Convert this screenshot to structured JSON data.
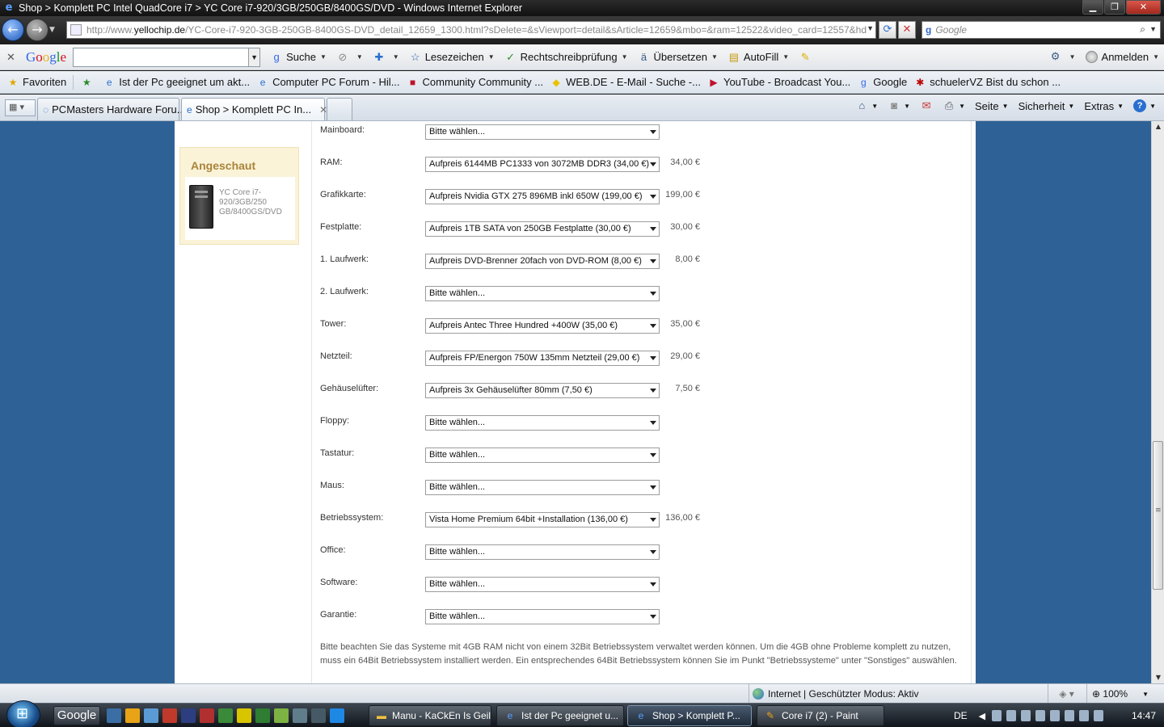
{
  "window": {
    "title": "Shop > Komplett PC Intel QuadCore i7 > YC Core i7-920/3GB/250GB/8400GS/DVD - Windows Internet Explorer",
    "minimize_glyph": "▁",
    "maximize_glyph": "❐",
    "close_glyph": "✕"
  },
  "address": {
    "prefix": "http://www.",
    "host": "yellochip.de",
    "path": "/YC-Core-i7-920-3GB-250GB-8400GS-DVD_detail_12659_1300.html?sDelete=&sViewport=detail&sArticle=12659&mbo=&ram=12522&video_card=12557&hd"
  },
  "search": {
    "engine_mark": "g",
    "placeholder": "Google"
  },
  "google_toolbar": {
    "logo": [
      "G",
      "o",
      "o",
      "g",
      "l",
      "e"
    ],
    "suche": "Suche",
    "lesezeichen": "Lesezeichen",
    "rechtschreib": "Rechtschreibprüfung",
    "uebersetzen": "Übersetzen",
    "autofill": "AutoFill",
    "anmelden": "Anmelden"
  },
  "favorites": {
    "label": "Favoriten",
    "items": [
      "Ist der Pc geeignet um akt...",
      "Computer PC Forum - Hil...",
      "Community  Community ...",
      "WEB.DE - E-Mail - Suche -...",
      "YouTube - Broadcast You...",
      "Google",
      "schuelerVZ  Bist du schon ..."
    ]
  },
  "tabs": [
    {
      "label": "PCMasters Hardware Foru..."
    },
    {
      "label": "Shop > Komplett PC In..."
    }
  ],
  "command_bar": {
    "seite": "Seite",
    "sicherheit": "Sicherheit",
    "extras": "Extras"
  },
  "sidebar": {
    "heading": "Angeschaut",
    "product_caption": "YC Core i7-920/3GB/250 GB/8400GS/DVD"
  },
  "config_rows": [
    {
      "label": "Mainboard:",
      "selected": "Bitte wählen...",
      "price": ""
    },
    {
      "label": "RAM:",
      "selected": "Aufpreis 6144MB PC1333 von 3072MB DDR3 (34,00 €)",
      "price": "34,00 €"
    },
    {
      "label": "Grafikkarte:",
      "selected": "Aufpreis Nvidia GTX 275 896MB inkl 650W (199,00 €)",
      "price": "199,00 €"
    },
    {
      "label": "Festplatte:",
      "selected": "Aufpreis 1TB SATA von 250GB Festplatte (30,00 €)",
      "price": "30,00 €"
    },
    {
      "label": "1. Laufwerk:",
      "selected": "Aufpreis DVD-Brenner 20fach von DVD-ROM (8,00 €)",
      "price": "8,00 €"
    },
    {
      "label": "2. Laufwerk:",
      "selected": "Bitte wählen...",
      "price": ""
    },
    {
      "label": "Tower:",
      "selected": "Aufpreis Antec Three Hundred +400W (35,00 €)",
      "price": "35,00 €"
    },
    {
      "label": "Netzteil:",
      "selected": "Aufpreis FP/Energon 750W 135mm Netzteil (29,00 €)",
      "price": "29,00 €"
    },
    {
      "label": "Gehäuselüfter:",
      "selected": "Aufpreis 3x Gehäuselüfter 80mm (7,50 €)",
      "price": "7,50 €"
    },
    {
      "label": "Floppy:",
      "selected": "Bitte wählen...",
      "price": ""
    },
    {
      "label": "Tastatur:",
      "selected": "Bitte wählen...",
      "price": ""
    },
    {
      "label": "Maus:",
      "selected": "Bitte wählen...",
      "price": ""
    },
    {
      "label": "Betriebssystem:",
      "selected": "Vista Home Premium 64bit +Installation (136,00 €)",
      "price": "136,00 €"
    },
    {
      "label": "Office:",
      "selected": "Bitte wählen...",
      "price": ""
    },
    {
      "label": "Software:",
      "selected": "Bitte wählen...",
      "price": ""
    },
    {
      "label": "Garantie:",
      "selected": "Bitte wählen...",
      "price": ""
    }
  ],
  "note": "Bitte beachten Sie das Systeme mit 4GB RAM nicht von einem 32Bit Betriebssystem verwaltet werden können. Um die 4GB ohne Probleme komplett zu nutzen, muss ein 64Bit Betriebssystem installiert werden. Ein entsprechendes 64Bit Betriebssystem können Sie im Punkt \"Betriebssysteme\" unter \"Sonstiges\" auswählen.",
  "status": {
    "zone": "Internet | Geschützter Modus: Aktiv",
    "zoom": "100%"
  },
  "taskbar": {
    "google": "Google",
    "tasks": [
      "Manu - KaCkEn Is Geil",
      "Ist der Pc geeignet u...",
      "Shop > Komplett P...",
      "Core i7 (2) - Paint"
    ],
    "lang": "DE",
    "clock": "14:47"
  }
}
